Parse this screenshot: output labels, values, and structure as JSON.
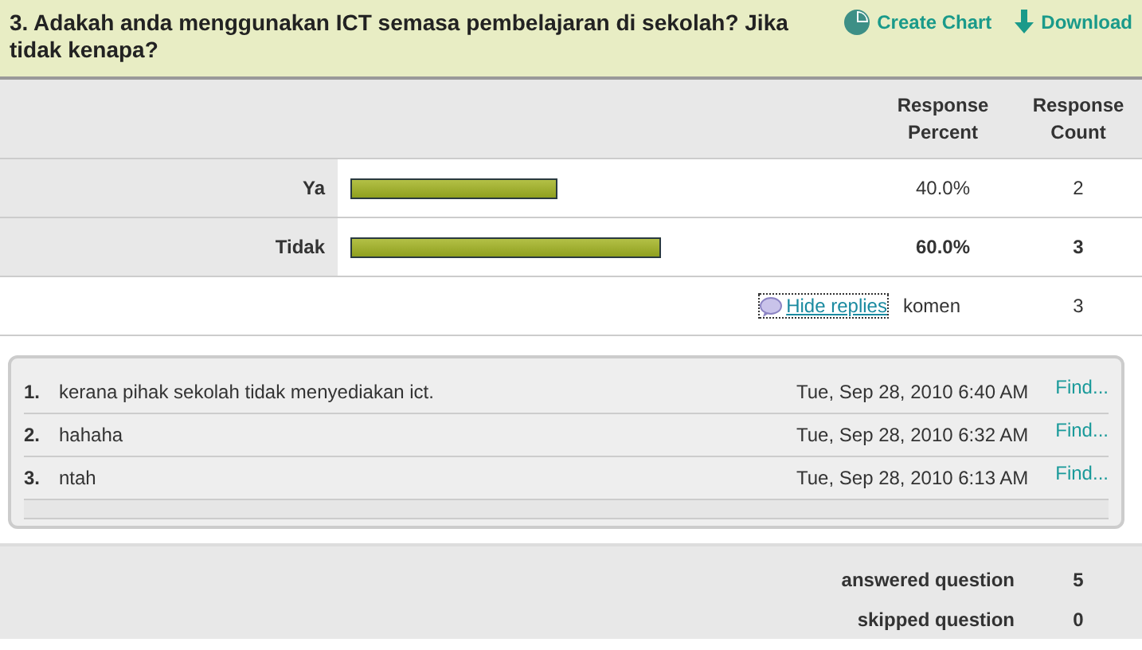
{
  "question": {
    "title": "3. Adakah anda menggunakan ICT semasa pembelajaran di sekolah? Jika tidak kenapa?",
    "actions": [
      {
        "kind": "chart",
        "label": "Create Chart"
      },
      {
        "kind": "download",
        "label": "Download"
      }
    ]
  },
  "table": {
    "columns": [
      "Response Percent",
      "Response Count"
    ],
    "rows": [
      {
        "label": "Ya",
        "percent": "40.0%",
        "count": "2",
        "emphasized": false
      },
      {
        "label": "Tidak",
        "percent": "60.0%",
        "count": "3",
        "emphasized": true
      }
    ],
    "replies_row": {
      "link": "Hide replies",
      "label": "komen",
      "count": "3"
    }
  },
  "replies": [
    {
      "number": "1.",
      "text": "kerana pihak sekolah tidak menyediakan ict.",
      "date": "Tue, Sep 28, 2010 6:40 AM",
      "link": "Find..."
    },
    {
      "number": "2.",
      "text": "hahaha",
      "date": "Tue, Sep 28, 2010 6:32 AM",
      "link": "Find..."
    },
    {
      "number": "3.",
      "text": "ntah",
      "date": "Tue, Sep 28, 2010 6:13 AM",
      "link": "Find..."
    }
  ],
  "summary": [
    {
      "label": "answered question",
      "value": "5"
    },
    {
      "label": "skipped question",
      "value": "0"
    }
  ]
}
